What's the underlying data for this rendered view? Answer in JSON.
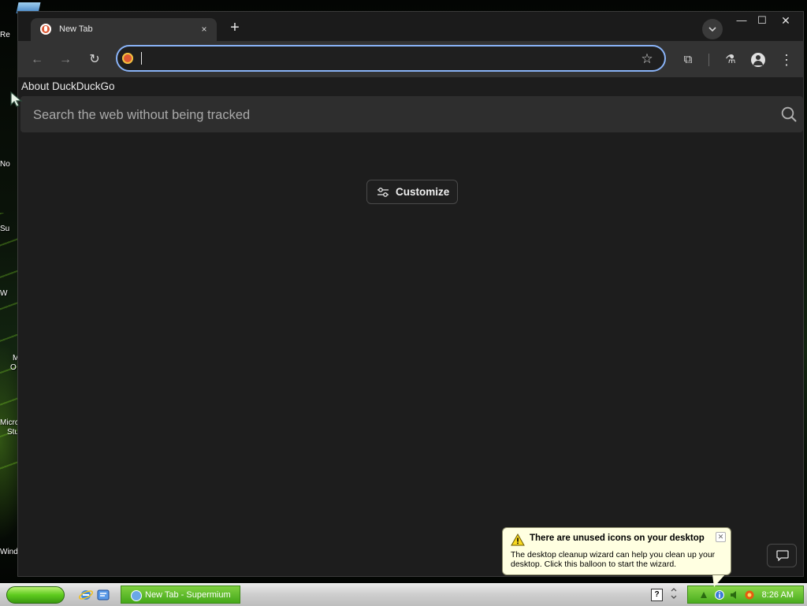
{
  "desktop": {
    "icons": [
      {
        "label": "Re"
      },
      {
        "label": "No"
      },
      {
        "label": "Su"
      },
      {
        "label": "W"
      },
      {
        "label": "M"
      },
      {
        "label": "O"
      },
      {
        "label": "Micro"
      },
      {
        "label": "Stu"
      },
      {
        "label": "Wind"
      }
    ]
  },
  "browser": {
    "tab": {
      "title": "New Tab",
      "close": "×"
    },
    "new_tab": "+",
    "window_controls": {
      "minimize": "—",
      "maximize": "☐",
      "close": "✕"
    },
    "toolbar": {
      "back": "←",
      "forward": "→",
      "reload": "↻",
      "star": "☆",
      "extensions": "⧉",
      "labs": "⚗",
      "menu": "⋮"
    },
    "address": {
      "value": ""
    }
  },
  "page": {
    "about_link": "About DuckDuckGo",
    "search": {
      "placeholder": "Search the web without being tracked"
    },
    "customize_label": "Customize"
  },
  "taskbar": {
    "task_item": "New Tab - Supermium",
    "help": "?",
    "clock": "8:26 AM"
  },
  "balloon": {
    "title": "There are unused icons on your desktop",
    "close": "✕",
    "text": "The desktop cleanup wizard can help you clean up your desktop. Click this balloon to start the wizard."
  }
}
